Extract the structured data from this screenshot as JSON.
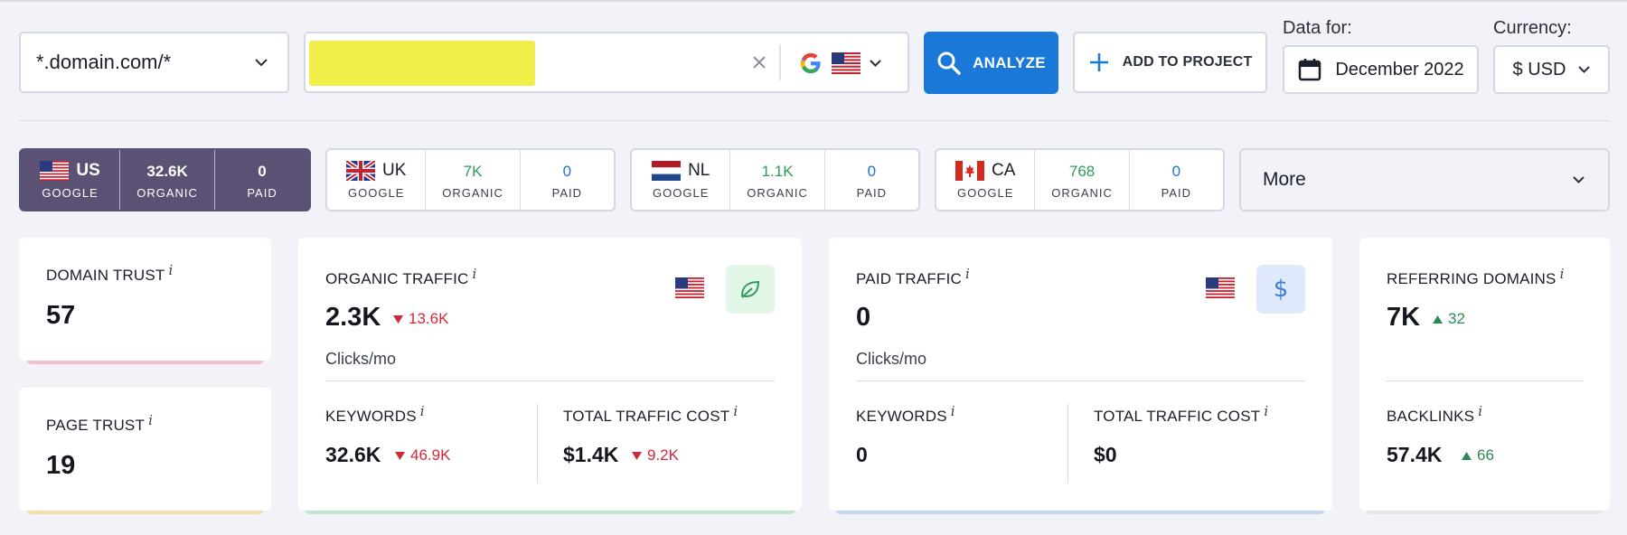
{
  "search": {
    "domain_mode": "*.domain.com/*",
    "query_value": "",
    "query_placeholder": "",
    "engine_icon": "google-logo",
    "engine_flag": "us-flag",
    "analyze_label": "ANALYZE",
    "add_project_label": "ADD TO PROJECT"
  },
  "data_for": {
    "label": "Data for:",
    "value": "December 2022"
  },
  "currency": {
    "label": "Currency:",
    "value": "$ USD"
  },
  "country_tabs": [
    {
      "code": "US",
      "engine": "GOOGLE",
      "organic": "32.6K",
      "organic_label": "ORGANIC",
      "paid": "0",
      "paid_label": "PAID",
      "active": true
    },
    {
      "code": "UK",
      "engine": "GOOGLE",
      "organic": "7K",
      "organic_label": "ORGANIC",
      "paid": "0",
      "paid_label": "PAID",
      "active": false
    },
    {
      "code": "NL",
      "engine": "GOOGLE",
      "organic": "1.1K",
      "organic_label": "ORGANIC",
      "paid": "0",
      "paid_label": "PAID",
      "active": false
    },
    {
      "code": "CA",
      "engine": "GOOGLE",
      "organic": "768",
      "organic_label": "ORGANIC",
      "paid": "0",
      "paid_label": "PAID",
      "active": false
    }
  ],
  "more_label": "More",
  "domain_trust": {
    "title": "DOMAIN TRUST",
    "value": "57"
  },
  "page_trust": {
    "title": "PAGE TRUST",
    "value": "19"
  },
  "organic_traffic": {
    "title": "ORGANIC TRAFFIC",
    "value": "2.3K",
    "delta": "13.6K",
    "unit": "Clicks/mo",
    "keywords_title": "KEYWORDS",
    "keywords_value": "32.6K",
    "keywords_delta": "46.9K",
    "cost_title": "TOTAL TRAFFIC COST",
    "cost_value": "$1.4K",
    "cost_delta": "9.2K"
  },
  "paid_traffic": {
    "title": "PAID TRAFFIC",
    "value": "0",
    "unit": "Clicks/mo",
    "keywords_title": "KEYWORDS",
    "keywords_value": "0",
    "cost_title": "TOTAL TRAFFIC COST",
    "cost_value": "$0"
  },
  "referring": {
    "title": "REFERRING DOMAINS",
    "value": "7K",
    "delta": "32",
    "backlinks_title": "BACKLINKS",
    "backlinks_value": "57.4K",
    "backlinks_delta": "66"
  },
  "info_marker": "i",
  "colors": {
    "accent_blue": "#1a78d9",
    "active_tab": "#5a5175",
    "down": "#d3283a",
    "up": "#2a8a4f",
    "accent_pink": "#f4bfcf",
    "accent_yellow": "#f1dfa8",
    "accent_green": "#bfe6cd",
    "accent_lightblue": "#c3d7f6",
    "accent_gray": "#e3e5ea"
  }
}
